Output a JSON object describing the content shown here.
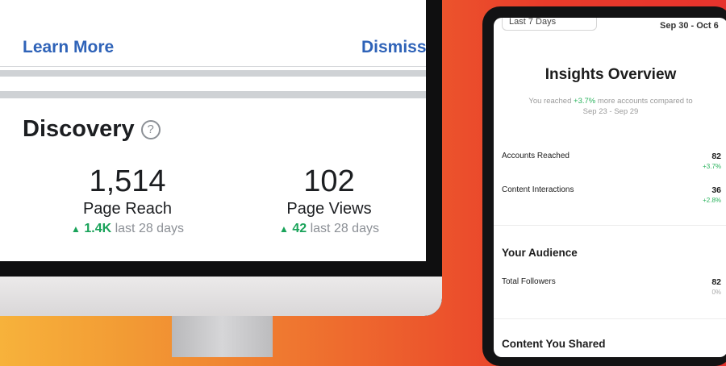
{
  "desktop": {
    "banner": {
      "learn_more": "Learn More",
      "dismiss": "Dismiss"
    },
    "discovery": {
      "title": "Discovery",
      "help_glyph": "?",
      "metrics": [
        {
          "value": "1,514",
          "label": "Page Reach",
          "change": "1.4K",
          "period": "last 28 days"
        },
        {
          "value": "102",
          "label": "Page Views",
          "change": "42",
          "period": "last 28 days"
        }
      ]
    }
  },
  "tablet": {
    "top_filter": "Last 7 Days",
    "top_date": "Sep 30 - Oct 6",
    "title": "Insights Overview",
    "subtitle_prefix": "You reached ",
    "subtitle_change": "+3.7%",
    "subtitle_suffix": " more accounts compared to Sep 23 - Sep 29",
    "rows": [
      {
        "label": "Accounts Reached",
        "value": "82",
        "change": "+3.7%"
      },
      {
        "label": "Content Interactions",
        "value": "36",
        "change": "+2.8%"
      }
    ],
    "audience": {
      "title": "Your Audience",
      "followers_label": "Total Followers",
      "followers_value": "82",
      "followers_change": "0%"
    },
    "content_title": "Content You Shared"
  },
  "colors": {
    "link_blue": "#2f63b8",
    "positive_green": "#1aa35a",
    "bg_orange": "#f29a34",
    "bg_red": "#e6332d"
  },
  "icons": {
    "help": "question-circle-icon",
    "trend_up": "triangle-up-icon"
  }
}
